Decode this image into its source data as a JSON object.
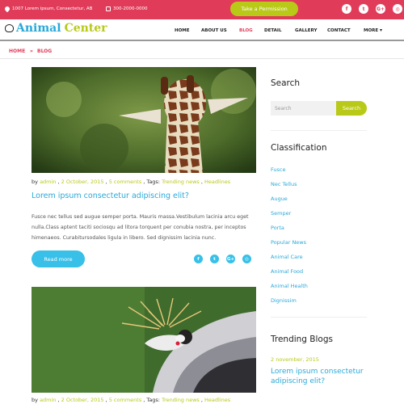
{
  "topbar": {
    "address": "1007 Lorem ipsum, Consectetur, AB",
    "phone": "300-2000-0000",
    "permission_label": "Take a Permission",
    "social": [
      "f",
      "t",
      "G+",
      "◎"
    ]
  },
  "logo": {
    "word1": "Animal",
    "word2": "Center"
  },
  "nav": [
    "HOME",
    "ABOUT US",
    "BLOG",
    "DETAIL",
    "GALLERY",
    "CONTACT",
    "MORE"
  ],
  "breadcrumb": {
    "home": "HOME",
    "sep": "»",
    "current": "BLOG"
  },
  "posts": [
    {
      "by": "by",
      "author": "admin",
      "date": "2 October, 2015",
      "comments": "5 comments",
      "tags_label": "Tags:",
      "tag1": "Trending news",
      "tag2": "Headlines",
      "title": "Lorem ipsum consectetur adipiscing elit?",
      "body": "Fusce nec tellus sed augue semper porta. Mauris massa.Vestibulum lacinia arcu eget nulla.Class aptent taciti sociosqu ad litora torquent per conubia nostra, per inceptos himenaeos. Curabitursodales ligula in libero. Sed dignissim lacinia nunc.",
      "read_more": "Read more"
    },
    {
      "by": "by",
      "author": "admin",
      "date": "2 October, 2015",
      "comments": "5 comments",
      "tags_label": "Tags:",
      "tag1": "Trending news",
      "tag2": "Headlines"
    }
  ],
  "post_social": [
    "f",
    "t",
    "G+",
    "◎"
  ],
  "sidebar": {
    "search_title": "Search",
    "search_placeholder": "Search",
    "search_button": "Search",
    "classification_title": "Classification",
    "categories": [
      "Fusce",
      "Nec Tellus",
      "Augue",
      "Semper",
      "Porta",
      "Popular News",
      "Animal Care",
      "Animal Food",
      "Animal Health",
      "Dignissim"
    ],
    "trending_title": "Trending Blogs",
    "trending_date": "2 november, 2015",
    "trending_post": "Lorem ipsum consectetur adipiscing elit?"
  },
  "colors": {
    "accent_red": "#e03c5a",
    "accent_green": "#b9c918",
    "accent_blue": "#2aa9d8"
  }
}
